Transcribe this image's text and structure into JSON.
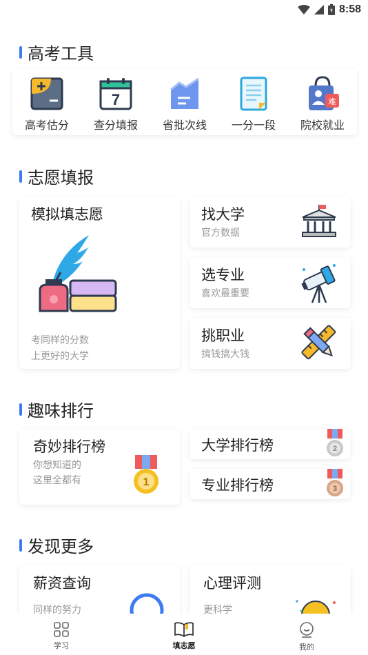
{
  "status": {
    "time": "8:58"
  },
  "sections": {
    "tools": {
      "title": "高考工具",
      "items": [
        {
          "label": "高考估分",
          "icon": "calculator-icon"
        },
        {
          "label": "查分填报",
          "icon": "calendar-icon",
          "badge": "7"
        },
        {
          "label": "省批次线",
          "icon": "chart-document-icon"
        },
        {
          "label": "一分一段",
          "icon": "notepad-icon"
        },
        {
          "label": "院校就业",
          "icon": "id-badge-icon",
          "badge": "难"
        }
      ]
    },
    "volunteer": {
      "title": "志愿填报",
      "mock": {
        "title": "模拟填志愿",
        "line1": "考同样的分数",
        "line2": "上更好的大学"
      },
      "find_univ": {
        "title": "找大学",
        "sub": "官方数据"
      },
      "choose_major": {
        "title": "选专业",
        "sub": "喜欢最重要"
      },
      "pick_job": {
        "title": "挑职业",
        "sub": "搞钱搞大钱"
      }
    },
    "ranking": {
      "title": "趣味排行",
      "wonder": {
        "title": "奇妙排行榜",
        "line1": "你想知道的",
        "line2": "这里全都有",
        "medal": "1"
      },
      "univ_rank": {
        "title": "大学排行榜",
        "medal": "2"
      },
      "major_rank": {
        "title": "专业排行榜",
        "medal": "3"
      }
    },
    "discover": {
      "title": "发现更多",
      "salary": {
        "title": "薪资查询",
        "sub": "同样的努力"
      },
      "psych": {
        "title": "心理评测",
        "sub": "更科学"
      }
    }
  },
  "nav": [
    {
      "label": "学习",
      "icon": "grid-icon",
      "active": false
    },
    {
      "label": "填志愿",
      "icon": "book-icon",
      "active": true
    },
    {
      "label": "我的",
      "icon": "user-icon",
      "active": false
    }
  ],
  "colors": {
    "accent": "#3e7bf3",
    "gold": "#f5c022",
    "silver": "#c8c8c8",
    "bronze": "#d9a584"
  }
}
